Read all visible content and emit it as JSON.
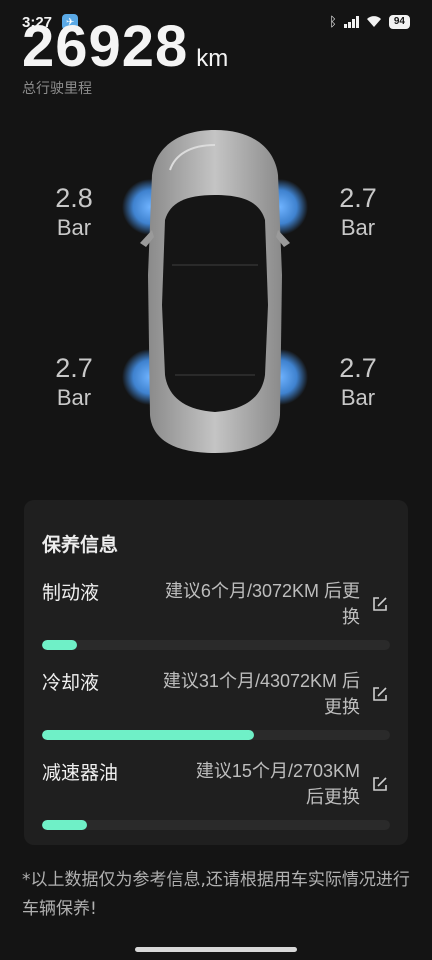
{
  "status_bar": {
    "time": "3:27",
    "battery": "94"
  },
  "odometer": {
    "value": "26928",
    "unit": "km",
    "label": "总行驶里程"
  },
  "tires": {
    "front_left": {
      "pressure": "2.8",
      "unit": "Bar"
    },
    "front_right": {
      "pressure": "2.7",
      "unit": "Bar"
    },
    "rear_left": {
      "pressure": "2.7",
      "unit": "Bar"
    },
    "rear_right": {
      "pressure": "2.7",
      "unit": "Bar"
    }
  },
  "maintenance": {
    "title": "保养信息",
    "items": [
      {
        "name": "制动液",
        "desc_line1": "建议6个月/3072KM 后更",
        "desc_line2": "换",
        "progress": 0.1
      },
      {
        "name": "冷却液",
        "desc_line1": "建议31个月/43072KM 后",
        "desc_line2": "更换",
        "progress": 0.61
      },
      {
        "name": "减速器油",
        "desc_line1": "建议15个月/2703KM",
        "desc_line2": "后更换",
        "progress": 0.13
      }
    ]
  },
  "note": "*以上数据仅为参考信息,还请根据用车实际情况进行车辆保养!",
  "colors": {
    "accent": "#6ff0c7",
    "tire_glow": "#4a90d9",
    "background": "#141414",
    "card": "#1f1f1f"
  }
}
